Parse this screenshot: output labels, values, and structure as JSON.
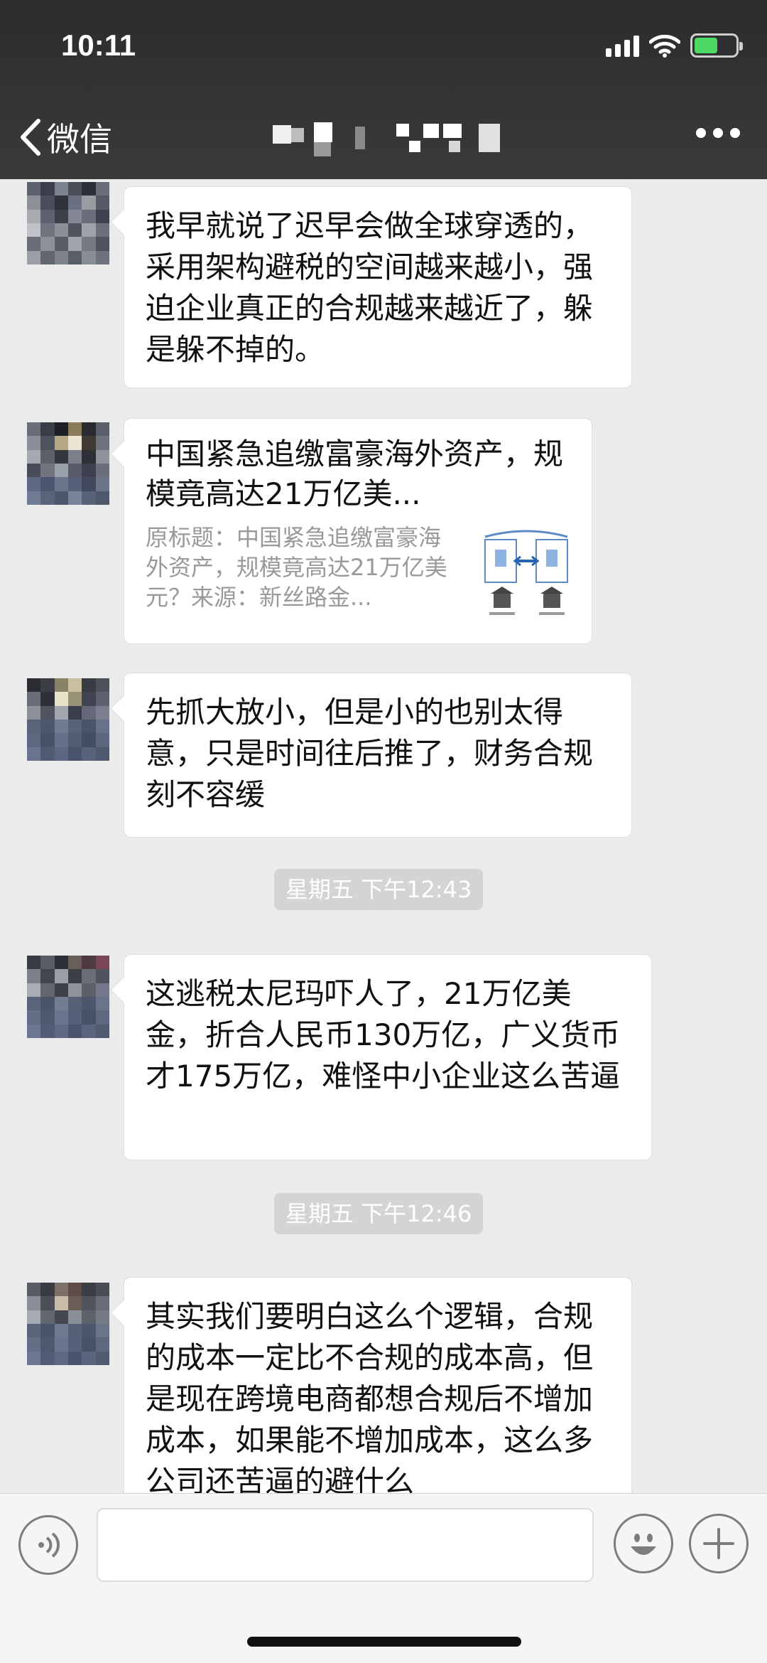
{
  "status_bar": {
    "time": "10:11"
  },
  "nav": {
    "back_label": "微信"
  },
  "messages": [
    {
      "type": "text",
      "text": "我早就说了迟早会做全球穿透的，采用架构避税的空间越来越小，强迫企业真正的合规越来越近了，躲是躲不掉的。"
    },
    {
      "type": "link",
      "title": "中国紧急追缴富豪海外资产，规模竟高达21万亿美...",
      "description": "原标题：中国紧急追缴富豪海外资产，规模竟高达21万亿美元？来源：新丝路金..."
    },
    {
      "type": "text",
      "text": "先抓大放小，但是小的也别太得意，只是时间往后推了，财务合规刻不容缓"
    },
    {
      "type": "time",
      "text": "星期五 下午12:43"
    },
    {
      "type": "text",
      "text": "这逃税太尼玛吓人了，21万亿美金，折合人民币130万亿，广义货币才175万亿，难怪中小企业这么苦逼"
    },
    {
      "type": "time",
      "text": "星期五 下午12:46"
    },
    {
      "type": "text",
      "text": "其实我们要明白这么个逻辑，合规的成本一定比不合规的成本高，但是现在跨境电商都想合规后不增加成本，如果能不增加成本，这么多公司还苦逼的避什么"
    }
  ],
  "colors": {
    "header_bg": "#2c2c2e",
    "chat_bg": "#ebebeb",
    "bubble_bg": "#ffffff",
    "battery_green": "#4cd964",
    "time_badge_bg": "#d4d4d4"
  },
  "icons": [
    "back-chevron-icon",
    "more-icon",
    "signal-icon",
    "wifi-icon",
    "battery-icon",
    "voice-icon",
    "emoji-icon",
    "plus-icon"
  ]
}
